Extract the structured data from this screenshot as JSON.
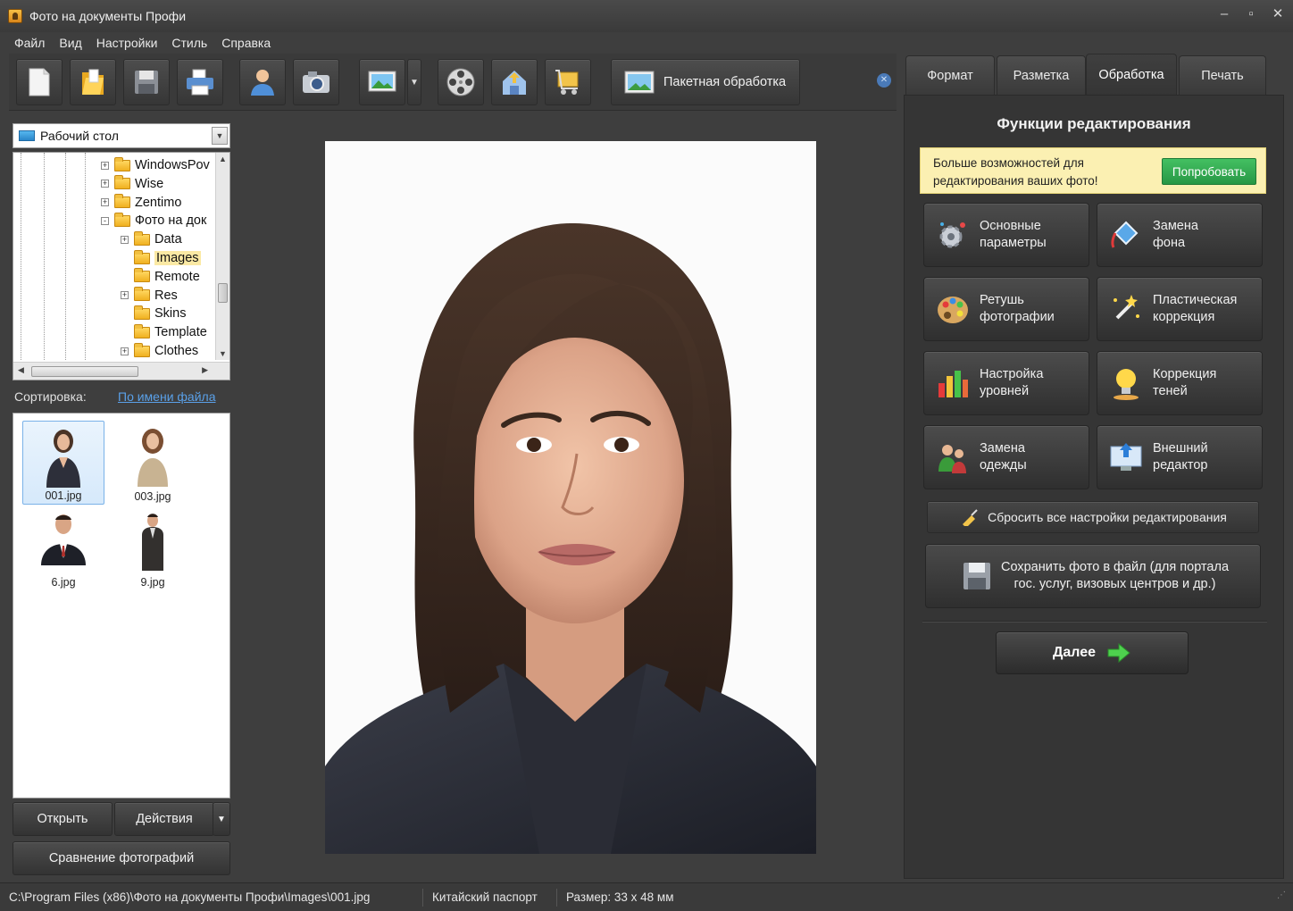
{
  "window": {
    "title": "Фото на документы Профи"
  },
  "menu": [
    "Файл",
    "Вид",
    "Настройки",
    "Стиль",
    "Справка"
  ],
  "toolbar": {
    "buttons": [
      "new-document-icon",
      "open-folder-icon",
      "save-icon",
      "print-icon",
      "person-icon",
      "camera-icon",
      "image-icon",
      "film-reel-icon",
      "upload-home-icon",
      "cart-icon"
    ],
    "batch_label": "Пакетная обработка"
  },
  "left_panel": {
    "folder": "Рабочий стол",
    "tree": [
      {
        "label": "WindowsPov",
        "expand": "+"
      },
      {
        "label": "Wise",
        "expand": "+"
      },
      {
        "label": "Zentimo",
        "expand": "+"
      },
      {
        "label": "Фото на док",
        "expand": "-"
      },
      {
        "label": "Data",
        "expand": "+"
      },
      {
        "label": "Images",
        "expand": ""
      },
      {
        "label": "Remote",
        "expand": ""
      },
      {
        "label": "Res",
        "expand": "+"
      },
      {
        "label": "Skins",
        "expand": ""
      },
      {
        "label": "Template",
        "expand": ""
      },
      {
        "label": "Clothes",
        "expand": "+"
      }
    ],
    "sort_label": "Сортировка:",
    "sort_value": "По имени файла",
    "files": [
      "001.jpg",
      "003.jpg",
      "6.jpg",
      "9.jpg"
    ],
    "open_label": "Открыть",
    "actions_label": "Действия",
    "compare_label": "Сравнение фотографий"
  },
  "tabs": [
    "Формат",
    "Разметка",
    "Обработка",
    "Печать"
  ],
  "active_tab": "Обработка",
  "right_panel": {
    "title": "Функции редактирования",
    "promo_text": "Больше возможностей для редактирования ваших фото!",
    "promo_button": "Попробовать",
    "functions": [
      {
        "label": "Основные\nпараметры",
        "icon": "gear-icon"
      },
      {
        "label": "Замена\nфона",
        "icon": "paint-bucket-icon"
      },
      {
        "label": "Ретушь\nфотографии",
        "icon": "palette-icon"
      },
      {
        "label": "Пластическая\nкоррекция",
        "icon": "magic-wand-icon"
      },
      {
        "label": "Настройка\nуровней",
        "icon": "bar-levels-icon"
      },
      {
        "label": "Коррекция\nтеней",
        "icon": "lightbulb-icon"
      },
      {
        "label": "Замена\nодежды",
        "icon": "people-icon"
      },
      {
        "label": "Внешний\nредактор",
        "icon": "monitor-upload-icon"
      }
    ],
    "reset_label": "Сбросить все настройки редактирования",
    "save_label": "Сохранить фото в файл (для портала\nгос. услуг, визовых центров и др.)",
    "next_label": "Далее"
  },
  "status": {
    "path": "C:\\Program Files (x86)\\Фото на документы Профи\\Images\\001.jpg",
    "format": "Китайский паспорт",
    "size": "Размер: 33 x 48 мм"
  }
}
